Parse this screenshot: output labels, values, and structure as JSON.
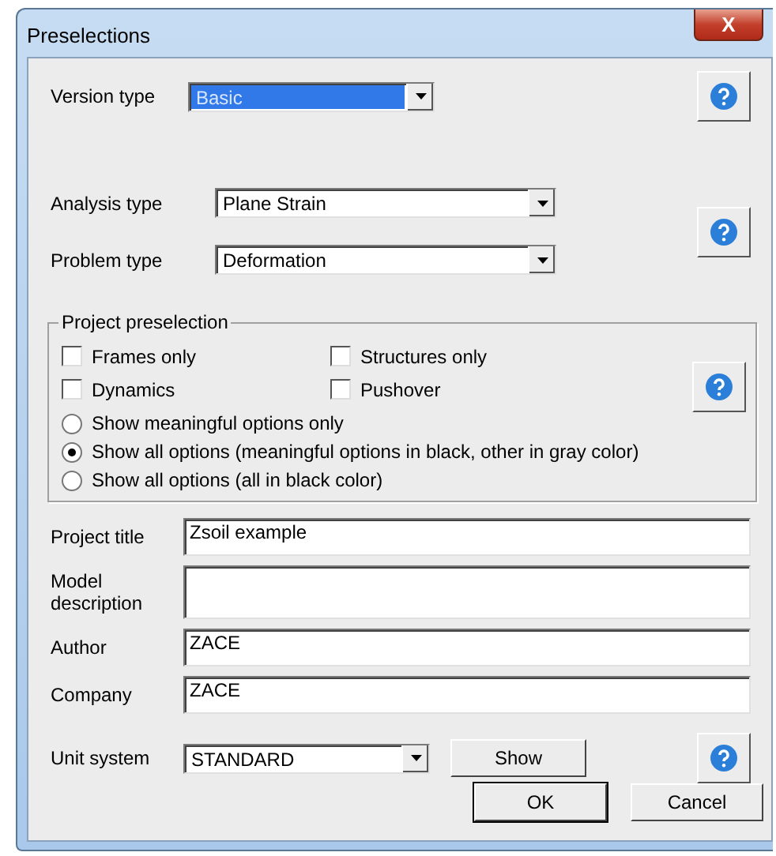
{
  "window": {
    "title": "Preselections",
    "close": "X"
  },
  "version_type": {
    "label": "Version type",
    "value": "Basic",
    "selected": true
  },
  "analysis_type": {
    "label": "Analysis type",
    "value": "Plane Strain",
    "selected": false
  },
  "problem_type": {
    "label": "Problem type",
    "value": "Deformation",
    "selected": false
  },
  "project_preselection": {
    "title": "Project preselection",
    "checkboxes": [
      {
        "label": "Frames only",
        "checked": false
      },
      {
        "label": "Structures only",
        "checked": false
      },
      {
        "label": "Dynamics",
        "checked": false
      },
      {
        "label": "Pushover",
        "checked": false
      }
    ],
    "radios": [
      {
        "label": "Show meaningful options only",
        "selected": false
      },
      {
        "label": "Show all options (meaningful options in black, other in gray color)",
        "selected": true
      },
      {
        "label": "Show all options (all in black color)",
        "selected": false
      }
    ]
  },
  "fields": [
    {
      "label": "Project title",
      "value": "Zsoil example",
      "kind": "single"
    },
    {
      "label": "Model description",
      "kind": "multi"
    },
    {
      "label": "Author",
      "value": "ZACE",
      "kind": "single"
    },
    {
      "label": "Company",
      "value": "ZACE",
      "kind": "single"
    }
  ],
  "unit_system": {
    "label": "Unit system",
    "value": "STANDARD",
    "selected": false,
    "button": "Show"
  },
  "buttons": [
    {
      "label": "OK",
      "default": true
    },
    {
      "label": "Cancel",
      "default": false
    }
  ]
}
